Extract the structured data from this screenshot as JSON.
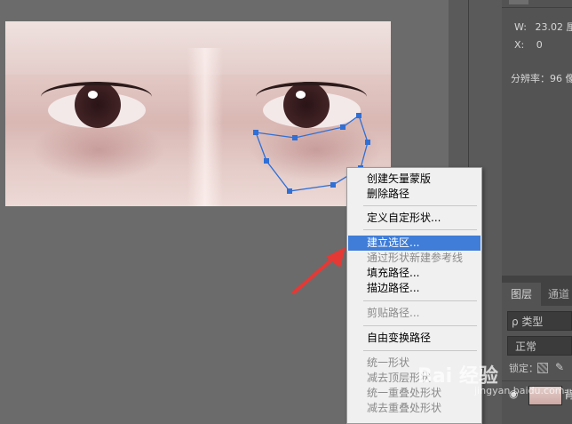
{
  "properties": {
    "width_label": "W:",
    "width_value": "23.02 厘",
    "x_label": "X:",
    "x_value": "0",
    "resolution": "分辨率：96 像"
  },
  "layers": {
    "tabs": [
      "图层",
      "通道"
    ],
    "search_placeholder": "ρ 类型",
    "blend_mode": "正常",
    "lock_label": "锁定：",
    "layer_name": "背"
  },
  "context_menu": {
    "items": [
      {
        "label": "创建矢量蒙版",
        "state": "normal"
      },
      {
        "label": "删除路径",
        "state": "normal"
      },
      {
        "label": "定义自定形状...",
        "state": "normal"
      },
      {
        "label": "建立选区...",
        "state": "highlighted"
      },
      {
        "label": "通过形状新建参考线",
        "state": "disabled"
      },
      {
        "label": "填充路径...",
        "state": "normal"
      },
      {
        "label": "描边路径...",
        "state": "normal"
      },
      {
        "label": "剪贴路径...",
        "state": "disabled"
      },
      {
        "label": "自由变换路径",
        "state": "normal"
      },
      {
        "label": "统一形状",
        "state": "disabled"
      },
      {
        "label": "减去顶层形状",
        "state": "disabled"
      },
      {
        "label": "统一重叠处形状",
        "state": "disabled"
      },
      {
        "label": "减去重叠处形状",
        "state": "disabled"
      }
    ]
  },
  "watermark": {
    "brand": "Bai 经验",
    "url": "jingyan.baidu.com"
  },
  "colors": {
    "accent": "#3f7dd8",
    "arrow": "#e53935",
    "anchor": "#2f6fd6",
    "panel": "#535353",
    "canvas_bg": "#6b6b6b"
  }
}
